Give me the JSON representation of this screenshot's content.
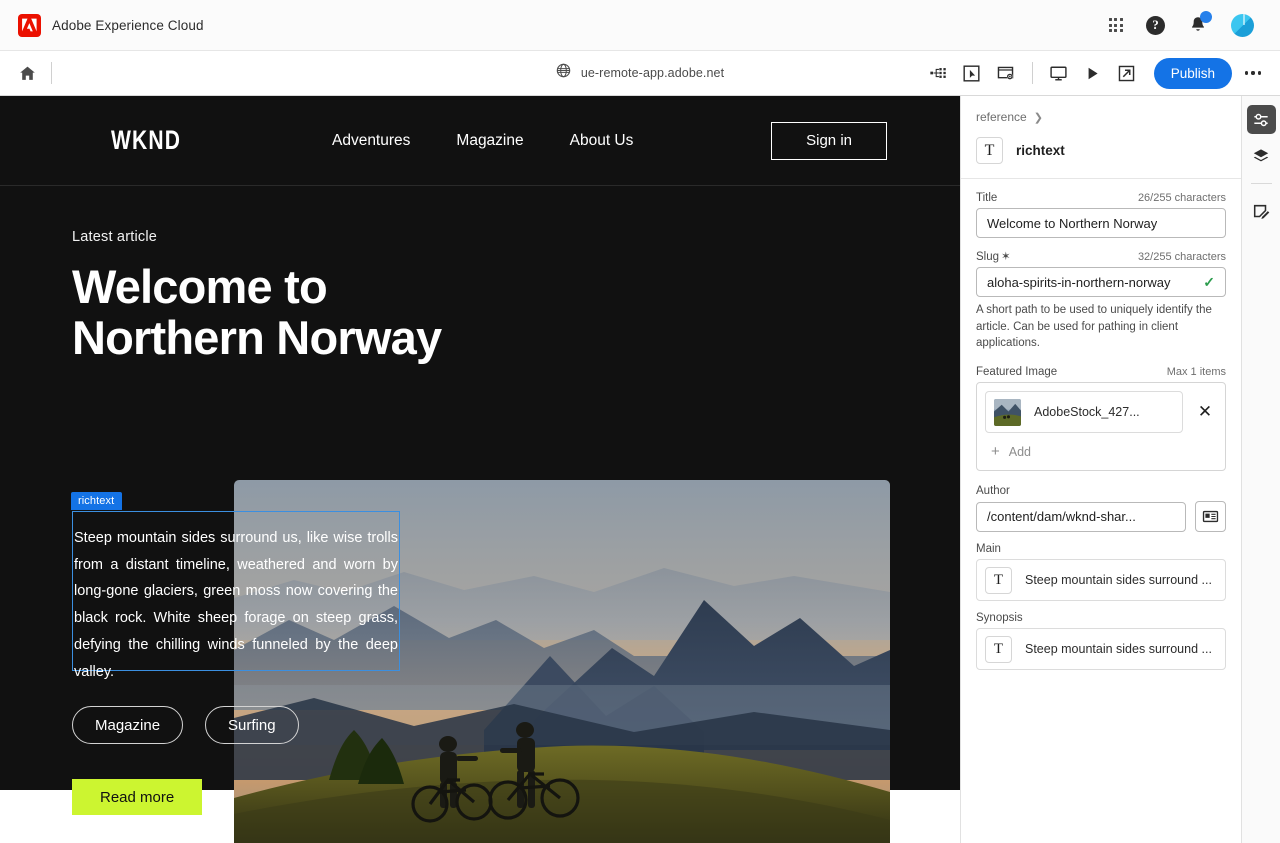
{
  "adobe_bar": {
    "title": "Adobe Experience Cloud",
    "logo_icon": "adobe-logo-icon",
    "apps_icon": "app-grid-icon",
    "help_icon": "help-circle-icon",
    "help_glyph": "?",
    "notifications_icon": "bell-icon",
    "avatar_icon": "user-avatar-icon"
  },
  "editor_bar": {
    "home_icon": "home-icon",
    "url": "ue-remote-app.adobe.net",
    "globe_icon": "globe-icon",
    "tools": [
      {
        "name": "page-tree-icon",
        "label": "Page tree"
      },
      {
        "name": "select-component-icon",
        "label": "Select component"
      },
      {
        "name": "page-properties-icon",
        "label": "Page properties"
      },
      {
        "name": "desktop-preview-icon",
        "label": "Desktop emulator"
      },
      {
        "name": "play-preview-icon",
        "label": "Preview"
      },
      {
        "name": "open-new-tab-icon",
        "label": "Open in new tab"
      }
    ],
    "publish_label": "Publish",
    "more_icon": "more-options-icon"
  },
  "canvas": {
    "site_logo": "WKND",
    "nav_links": [
      "Adventures",
      "Magazine",
      "About Us"
    ],
    "signin_label": "Sign in",
    "eyebrow": "Latest article",
    "hero_title_line1": "Welcome to",
    "hero_title_line2": "Northern Norway",
    "selection_badge": "richtext",
    "body_text": "Steep mountain sides surround us, like wise trolls from a distant timeline, weathered and worn by long-gone glaciers, green moss now covering the black rock. White sheep forage on steep grass, defying the chilling winds funneled by the deep valley.",
    "tags": [
      "Magazine",
      "Surfing"
    ],
    "cta_label": "Read more",
    "hero_image_alt": "Two mountain bikers on a grassy ridge at sunset with layered blue mountains",
    "colors": {
      "page_background": "#111111",
      "cta_background": "#ccf530",
      "selection_outline": "#3b8fe0",
      "selection_badge_bg": "#1473e6"
    }
  },
  "properties": {
    "breadcrumb": "reference",
    "breadcrumb_chevron": "chevron-right-icon",
    "component_icon": "text-component-icon",
    "component_icon_glyph": "T",
    "component_name": "richtext",
    "title_field": {
      "label": "Title",
      "counter": "26/255 characters",
      "value": "Welcome to Northern Norway"
    },
    "slug_field": {
      "label": "Slug",
      "required_mark": "✶",
      "counter": "32/255 characters",
      "value": "aloha-spirits-in-northern-norway",
      "valid_icon": "checkmark-icon",
      "valid_glyph": "✓",
      "help_text": "A short path to be used to uniquely identify the article. Can be used for pathing in client applications."
    },
    "featured_image": {
      "label": "Featured Image",
      "max_label": "Max 1 items",
      "asset_name": "AdobeStock_427...",
      "thumbnail_icon": "asset-thumbnail",
      "remove_icon": "close-icon",
      "add_label": "Add",
      "add_icon": "plus-icon"
    },
    "author_field": {
      "label": "Author",
      "value": "/content/dam/wknd-shar...",
      "picker_icon": "content-fragment-picker-icon"
    },
    "main_field": {
      "label": "Main",
      "icon": "text-component-icon",
      "icon_glyph": "T",
      "value": "Steep mountain sides surround ..."
    },
    "synopsis_field": {
      "label": "Synopsis",
      "icon": "text-component-icon",
      "icon_glyph": "T",
      "value": "Steep mountain sides surround ..."
    }
  },
  "rail": {
    "items": [
      {
        "name": "properties-rail-icon",
        "label": "Properties",
        "active": true
      },
      {
        "name": "layers-rail-icon",
        "label": "Content tree",
        "active": false
      },
      {
        "name": "edit-note-rail-icon",
        "label": "Annotations",
        "active": false
      }
    ]
  }
}
